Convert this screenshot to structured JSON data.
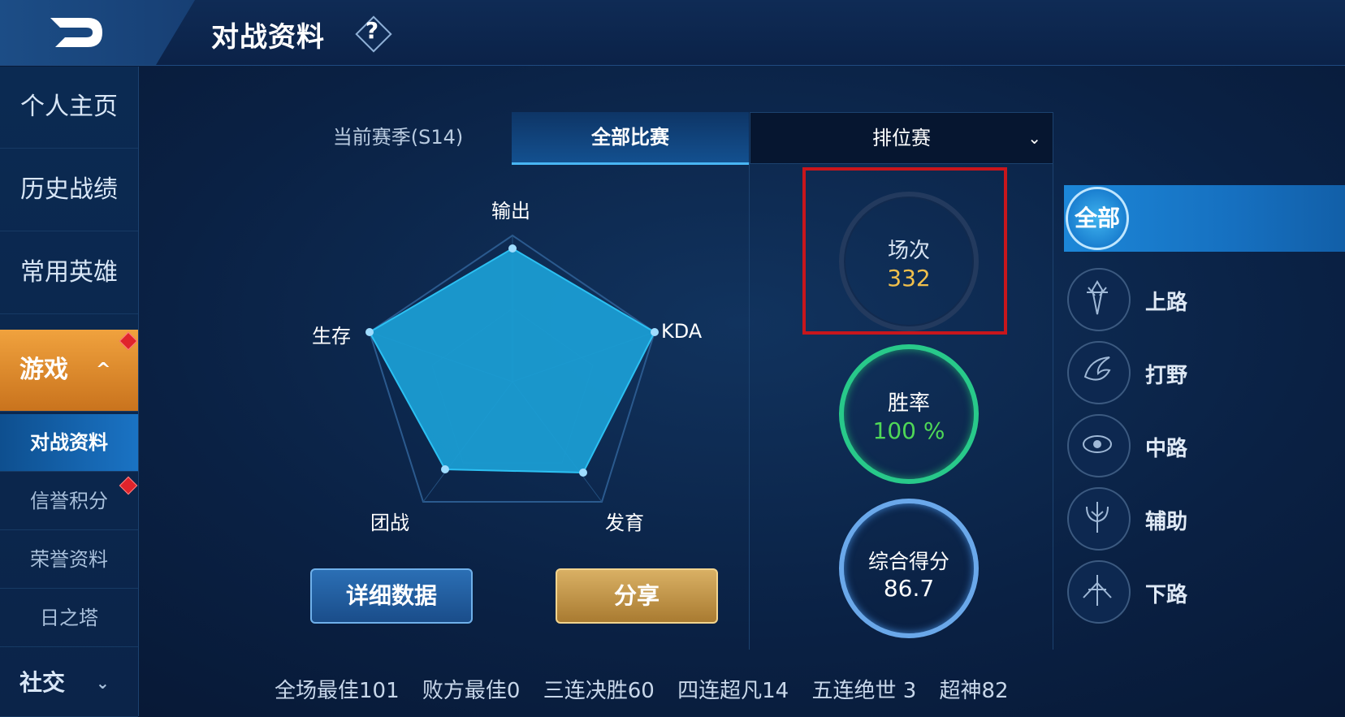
{
  "header": {
    "title": "对战资料",
    "help": "?"
  },
  "sidebar": {
    "items": [
      {
        "label": "个人主页"
      },
      {
        "label": "历史战绩"
      },
      {
        "label": "常用英雄"
      }
    ],
    "game": {
      "label": "游戏",
      "chevron": "^"
    },
    "sub_items": [
      {
        "label": "对战资料"
      },
      {
        "label": "信誉积分"
      },
      {
        "label": "荣誉资料"
      },
      {
        "label": "日之塔"
      }
    ],
    "social": {
      "label": "社交",
      "chevron": "⌄"
    }
  },
  "tabs": {
    "season": "当前赛季(S14)",
    "all": "全部比赛",
    "dropdown_value": "排位赛",
    "dropdown_chevron": "⌄"
  },
  "radar": {
    "labels": {
      "top": "输出",
      "right": "KDA",
      "bottom_right": "发育",
      "bottom_left": "团战",
      "left": "生存"
    }
  },
  "buttons": {
    "detail": "详细数据",
    "share": "分享"
  },
  "stats": {
    "matches": {
      "label": "场次",
      "value": "332"
    },
    "winrate": {
      "label": "胜率",
      "value": "100 %"
    },
    "score": {
      "label": "综合得分",
      "value": "86.7"
    }
  },
  "roles": {
    "all": "全部",
    "items": [
      {
        "label": "上路",
        "icon": "top-lane-icon"
      },
      {
        "label": "打野",
        "icon": "jungle-icon"
      },
      {
        "label": "中路",
        "icon": "mid-lane-icon"
      },
      {
        "label": "辅助",
        "icon": "support-icon"
      },
      {
        "label": "下路",
        "icon": "bottom-lane-icon"
      }
    ]
  },
  "bottom": {
    "mvp": "全场最佳101",
    "loser_mvp": "败方最佳0",
    "triple": "三连决胜60",
    "quadra": "四连超凡14",
    "penta": "五连绝世 3",
    "legendary": "超神82"
  },
  "colors": {
    "accent_gold": "#f1c04b",
    "win_green": "#4fd857",
    "highlight_red": "#c8161c"
  }
}
